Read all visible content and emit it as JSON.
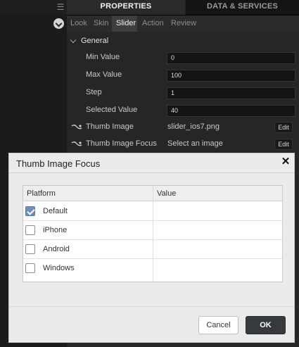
{
  "header": {
    "tabs": [
      {
        "label": "PROPERTIES"
      },
      {
        "label": "DATA & SERVICES"
      }
    ]
  },
  "subtabs": [
    {
      "label": "Look"
    },
    {
      "label": "Skin"
    },
    {
      "label": "Slider",
      "active": true
    },
    {
      "label": "Action"
    },
    {
      "label": "Review"
    }
  ],
  "group": {
    "title": "General"
  },
  "properties": [
    {
      "label": "Min Value",
      "value": "0"
    },
    {
      "label": "Max Value",
      "value": "100"
    },
    {
      "label": "Step",
      "value": "1"
    },
    {
      "label": "Selected Value",
      "value": "40"
    }
  ],
  "image_props": [
    {
      "label": "Thumb Image",
      "value": "slider_ios7.png",
      "button": "Edit"
    },
    {
      "label": "Thumb Image Focus",
      "value": "Select an image",
      "button": "Edit"
    }
  ],
  "dialog": {
    "title": "Thumb Image Focus",
    "close_icon": "close-icon",
    "columns": {
      "platform": "Platform",
      "value": "Value"
    },
    "rows": [
      {
        "label": "Default",
        "checked": true,
        "value": ""
      },
      {
        "label": "iPhone",
        "checked": false,
        "value": ""
      },
      {
        "label": "Android",
        "checked": false,
        "value": ""
      },
      {
        "label": "Windows",
        "checked": false,
        "value": ""
      }
    ],
    "cancel_label": "Cancel",
    "ok_label": "OK"
  },
  "colors": {
    "ok_button": "#36393d",
    "checkbox_checked": "#6f8fb7"
  }
}
